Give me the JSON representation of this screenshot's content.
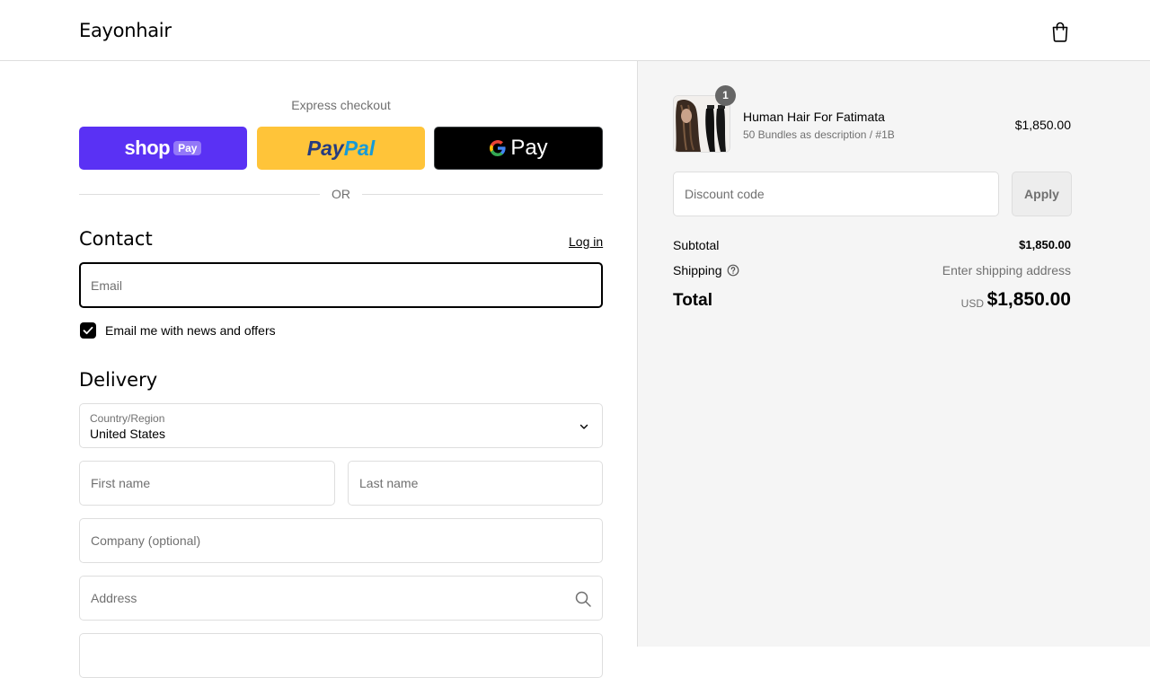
{
  "header": {
    "brand": "Eayonhair",
    "cart_icon": "shopping-bag-icon"
  },
  "express": {
    "label": "Express checkout",
    "shop_pay": {
      "text": "shop",
      "pill": "Pay"
    },
    "paypal": {
      "part1": "Pay",
      "part2": "Pal"
    },
    "gpay": {
      "text": "Pay"
    },
    "or": "OR"
  },
  "contact": {
    "title": "Contact",
    "login": "Log in",
    "email_placeholder": "Email",
    "newsletter_label": "Email me with news and offers",
    "newsletter_checked": true
  },
  "delivery": {
    "title": "Delivery",
    "country_label": "Country/Region",
    "country_value": "United States",
    "first_name_placeholder": "First name",
    "last_name_placeholder": "Last name",
    "company_placeholder": "Company (optional)",
    "address_placeholder": "Address"
  },
  "summary": {
    "item": {
      "title": "Human Hair For Fatimata",
      "variant": "50 Bundles as description / #1B",
      "price": "$1,850.00",
      "quantity": "1"
    },
    "discount_placeholder": "Discount code",
    "apply_label": "Apply",
    "subtotal_label": "Subtotal",
    "subtotal_value": "$1,850.00",
    "shipping_label": "Shipping",
    "shipping_value": "Enter shipping address",
    "total_label": "Total",
    "total_currency": "USD",
    "total_value": "$1,850.00"
  },
  "colors": {
    "shop_pay": "#5a31f4",
    "paypal": "#ffc439",
    "gpay": "#000000"
  }
}
